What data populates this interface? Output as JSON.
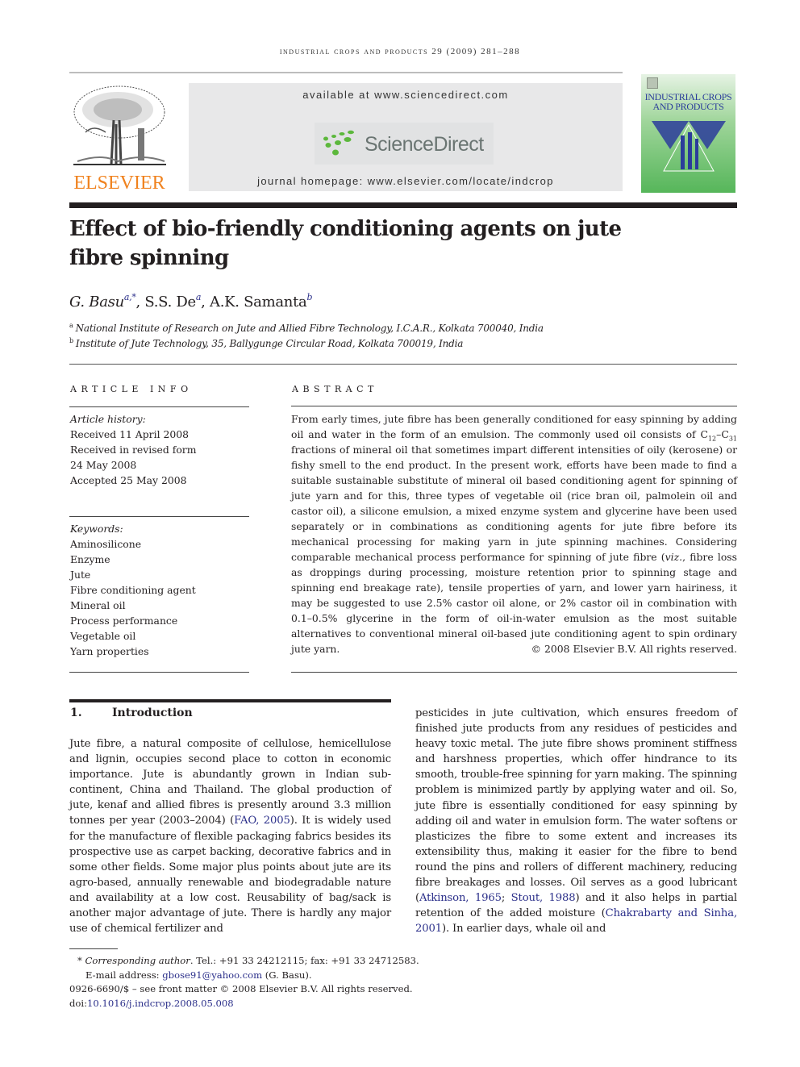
{
  "running_header": "industrial crops and products 29 (2009) 281–288",
  "publisher": {
    "logo_word": "ELSEVIER",
    "logo_icon": "elsevier-tree-icon"
  },
  "sciencedirect": {
    "available_text": "available at www.sciencedirect.com",
    "logo_text": "ScienceDirect",
    "homepage_text": "journal homepage: www.elsevier.com/locate/indcrop"
  },
  "journal_cover": {
    "title_line1": "INDUSTRIAL CROPS",
    "title_line2": "AND PRODUCTS"
  },
  "article": {
    "title": "Effect of bio-friendly conditioning agents on jute fibre spinning",
    "authors": [
      {
        "name": "G. Basu",
        "affil": "a,*"
      },
      {
        "name": "S.S. De",
        "affil": "a"
      },
      {
        "name": "A.K. Samanta",
        "affil": "b"
      }
    ],
    "affiliations": [
      {
        "mark": "a",
        "text": "National Institute of Research on Jute and Allied Fibre Technology, I.C.A.R., Kolkata 700040, India"
      },
      {
        "mark": "b",
        "text": "Institute of Jute Technology, 35, Ballygunge Circular Road, Kolkata 700019, India"
      }
    ]
  },
  "article_info": {
    "heading": "article info",
    "history_label": "Article history:",
    "history": [
      "Received 11 April 2008",
      "Received in revised form",
      "24 May 2008",
      "Accepted 25 May 2008"
    ],
    "keywords_label": "Keywords:",
    "keywords": [
      "Aminosilicone",
      "Enzyme",
      "Jute",
      "Fibre conditioning agent",
      "Mineral oil",
      "Process performance",
      "Vegetable oil",
      "Yarn properties"
    ]
  },
  "abstract": {
    "heading": "abstract",
    "text_part1": "From early times, jute fibre has been generally conditioned for easy spinning by adding oil and water in the form of an emulsion. The commonly used oil consists of C",
    "sub1": "12",
    "text_part2": "–C",
    "sub2": "31",
    "text_part3": " fractions of mineral oil that sometimes impart different intensities of oily (kerosene) or fishy smell to the end product. In the present work, efforts have been made to find a suitable sustainable substitute of mineral oil based conditioning agent for spinning of jute yarn and for this, three types of vegetable oil (rice bran oil, palmolein oil and castor oil), a silicone emulsion, a mixed enzyme system and glycerine have been used separately or in combinations as conditioning agents for jute fibre before its mechanical processing for making yarn in jute spinning machines. Considering comparable mechanical process performance for spinning of jute fibre (",
    "viz": "viz.",
    "text_part4": ", fibre loss as droppings during processing, moisture retention prior to spinning stage and spinning end breakage rate), tensile properties of yarn, and lower yarn hairiness, it may be suggested to use 2.5% castor oil alone, or 2% castor oil in combination with 0.1–0.5% glycerine in the form of oil-in-water emulsion as the most suitable alternatives to conventional mineral oil-based jute conditioning agent to spin ordinary jute yarn.",
    "copyright": "© 2008 Elsevier B.V. All rights reserved."
  },
  "introduction": {
    "number": "1.",
    "heading": "Introduction",
    "left_p1": "Jute fibre, a natural composite of cellulose, hemicellulose and lignin, occupies second place to cotton in economic importance. Jute is abundantly grown in Indian sub-continent, China and Thailand. The global production of jute, kenaf and allied fibres is presently around 3.3 million tonnes per year (2003–2004) (",
    "cite_fao": "FAO, 2005",
    "left_p2": "). It is widely used for the manufacture of flexible packaging fabrics besides its prospective use as carpet backing, decorative fabrics and in some other fields. Some major plus points about jute are its agro-based, annually renewable and biodegradable nature and availability at a low cost. Reusability of bag/sack is another major advantage of jute. There is hardly any major use of chemical fertilizer and",
    "right_p1": "pesticides in jute cultivation, which ensures freedom of finished jute products from any residues of pesticides and heavy toxic metal. The jute fibre shows prominent stiffness and harshness properties, which offer hindrance to its smooth, trouble-free spinning for yarn making. The spinning problem is minimized partly by applying water and oil. So, jute fibre is essentially conditioned for easy spinning by adding oil and water in emulsion form. The water softens or plasticizes the fibre to some extent and increases its extensibility thus, making it easier for the fibre to bend round the pins and rollers of different machinery, reducing fibre breakages and losses. Oil serves as a good lubricant (",
    "cite_atkinson": "Atkinson, 1965",
    "sep": "; ",
    "cite_stout": "Stout, 1988",
    "right_p2": ") and it also helps in partial retention of the added moisture (",
    "cite_chakrabarty": "Chakrabarty and Sinha, 2001",
    "right_p3": "). In earlier days, whale oil and"
  },
  "footnotes": {
    "star": "*",
    "corr_label": "Corresponding author",
    "corr_text": ". Tel.: +91 33 24212115; fax: +91 33 24712583.",
    "email_label": "E-mail address: ",
    "email": "gbose91@yahoo.com",
    "email_suffix": " (G. Basu).",
    "front_matter": "0926-6690/$ – see front matter © 2008 Elsevier B.V. All rights reserved.",
    "doi_label": "doi:",
    "doi": "10.1016/j.indcrop.2008.05.008"
  },
  "colors": {
    "elsevier_orange": "#f0821e",
    "link_blue": "#2b2f8a",
    "sd_green": "#5cb83c",
    "sd_gray": "#6a7572"
  }
}
